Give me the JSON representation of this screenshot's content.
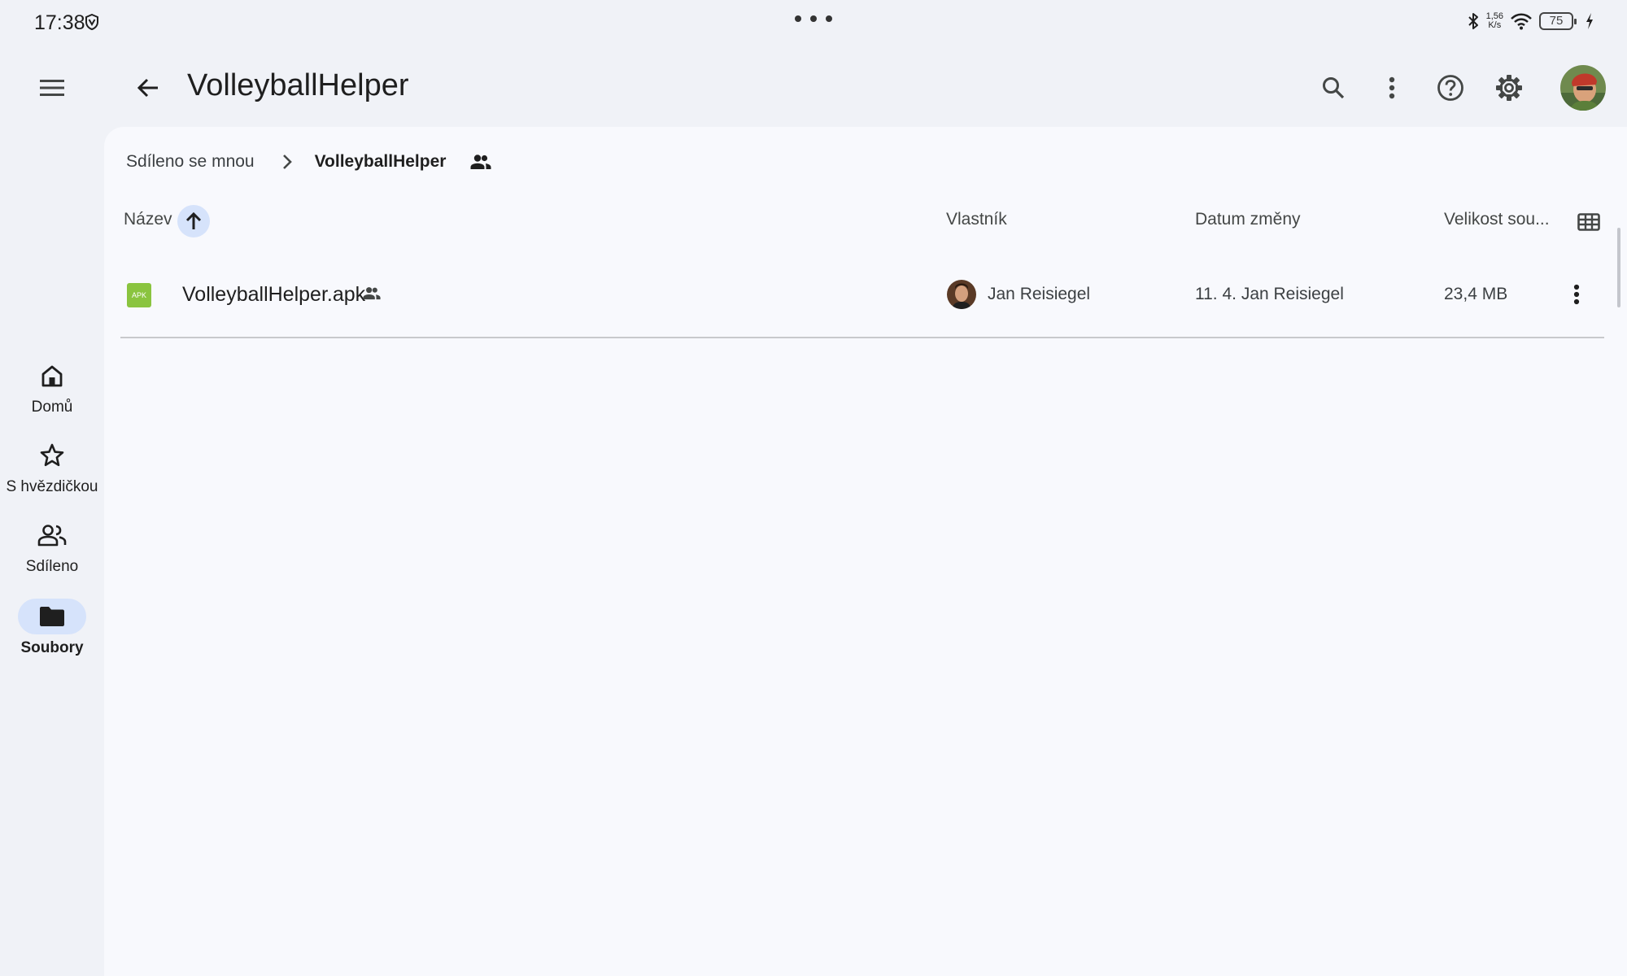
{
  "status_bar": {
    "time": "17:38",
    "net_speed_value": "1,56",
    "net_speed_unit": "K/s",
    "battery": "75",
    "icons": [
      "vpn-shield-icon",
      "more-dots-icon",
      "bluetooth-icon",
      "wifi-icon",
      "battery-icon",
      "charging-icon"
    ]
  },
  "app_bar": {
    "title": "VolleyballHelper",
    "icons": [
      "menu-icon",
      "back-arrow-icon",
      "search-icon",
      "more-vert-icon",
      "help-icon",
      "settings-gear-icon",
      "account-avatar"
    ]
  },
  "breadcrumb": {
    "items": [
      "Sdíleno se mnou",
      "VolleyballHelper"
    ],
    "separator_icon": "chevron-right-icon",
    "shared_icon": "people-icon"
  },
  "columns": {
    "name": "Název",
    "owner": "Vlastník",
    "modified": "Datum změny",
    "size": "Velikost sou...",
    "sort_direction": "ascending",
    "view_toggle_icon": "grid-view-icon"
  },
  "files": [
    {
      "name": "VolleyballHelper.apk",
      "type_badge": "APK",
      "shared": true,
      "owner": "Jan Reisiegel",
      "modified": "11. 4. Jan Reisiegel",
      "size": "23,4 MB"
    }
  ],
  "nav": {
    "items": [
      {
        "label": "Domů",
        "icon": "home-icon",
        "active": false
      },
      {
        "label": "S hvězdičkou",
        "icon": "star-icon",
        "active": false
      },
      {
        "label": "Sdíleno",
        "icon": "shared-people-icon",
        "active": false
      },
      {
        "label": "Soubory",
        "icon": "folder-icon",
        "active": true
      }
    ]
  },
  "colors": {
    "background": "#f0f2f7",
    "panel": "#f8f9fd",
    "accent_pill": "#d6e3fb",
    "apk_green": "#8ac43f"
  }
}
